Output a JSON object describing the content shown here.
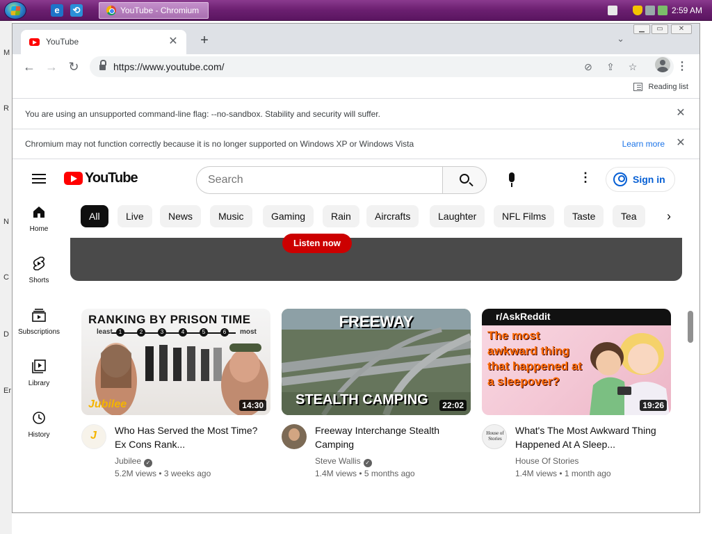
{
  "taskbar": {
    "window_title": "YouTube - Chromium",
    "clock": "2:59 AM"
  },
  "desktop": {
    "labels": [
      "M",
      "R",
      "N",
      "C",
      "D",
      "Er"
    ]
  },
  "browser": {
    "tab_title": "YouTube",
    "url": "https://www.youtube.com/",
    "reading_list": "Reading list",
    "infobar1": "You are using an unsupported command-line flag: --no-sandbox. Stability and security will suffer.",
    "infobar2": "Chromium may not function correctly because it is no longer supported on Windows XP or Windows Vista",
    "learn_more": "Learn more"
  },
  "youtube": {
    "logo_text": "YouTube",
    "search_placeholder": "Search",
    "sign_in": "Sign in",
    "sidebar": [
      {
        "label": "Home",
        "icon": "home-icon"
      },
      {
        "label": "Shorts",
        "icon": "shorts-icon"
      },
      {
        "label": "Subscriptions",
        "icon": "subscriptions-icon"
      },
      {
        "label": "Library",
        "icon": "library-icon"
      },
      {
        "label": "History",
        "icon": "history-icon"
      }
    ],
    "chips": [
      "All",
      "Live",
      "News",
      "Music",
      "Gaming",
      "Rain",
      "Aircrafts",
      "Laughter",
      "NFL Films",
      "Taste",
      "Tea"
    ],
    "banner_button": "Listen now",
    "videos": [
      {
        "title": "Who Has Served the Most Time? Ex Cons Rank...",
        "channel": "Jubilee",
        "verified": true,
        "meta": "5.2M views • 3 weeks ago",
        "duration": "14:30",
        "thumb_text": "RANKING BY PRISON TIME",
        "thumb_least": "least",
        "thumb_most": "most",
        "thumb_brand": "Jubilee"
      },
      {
        "title": "Freeway Interchange Stealth Camping",
        "channel": "Steve Wallis",
        "verified": true,
        "meta": "1.4M views • 5 months ago",
        "duration": "22:02",
        "thumb_top": "FREEWAY",
        "thumb_bottom": "STEALTH CAMPING"
      },
      {
        "title": "What's The Most Awkward Thing Happened At A Sleep...",
        "channel": "House Of Stories",
        "verified": false,
        "meta": "1.4M views • 1 month ago",
        "duration": "19:26",
        "thumb_head": "r/AskReddit",
        "thumb_text": "The most awkward thing that happened at a sleepover?",
        "avatar_text": "House of Stories"
      }
    ]
  },
  "colors": {
    "taskbar": "#6b1f70",
    "yt_red": "#ff0000",
    "link_blue": "#065fd4"
  }
}
